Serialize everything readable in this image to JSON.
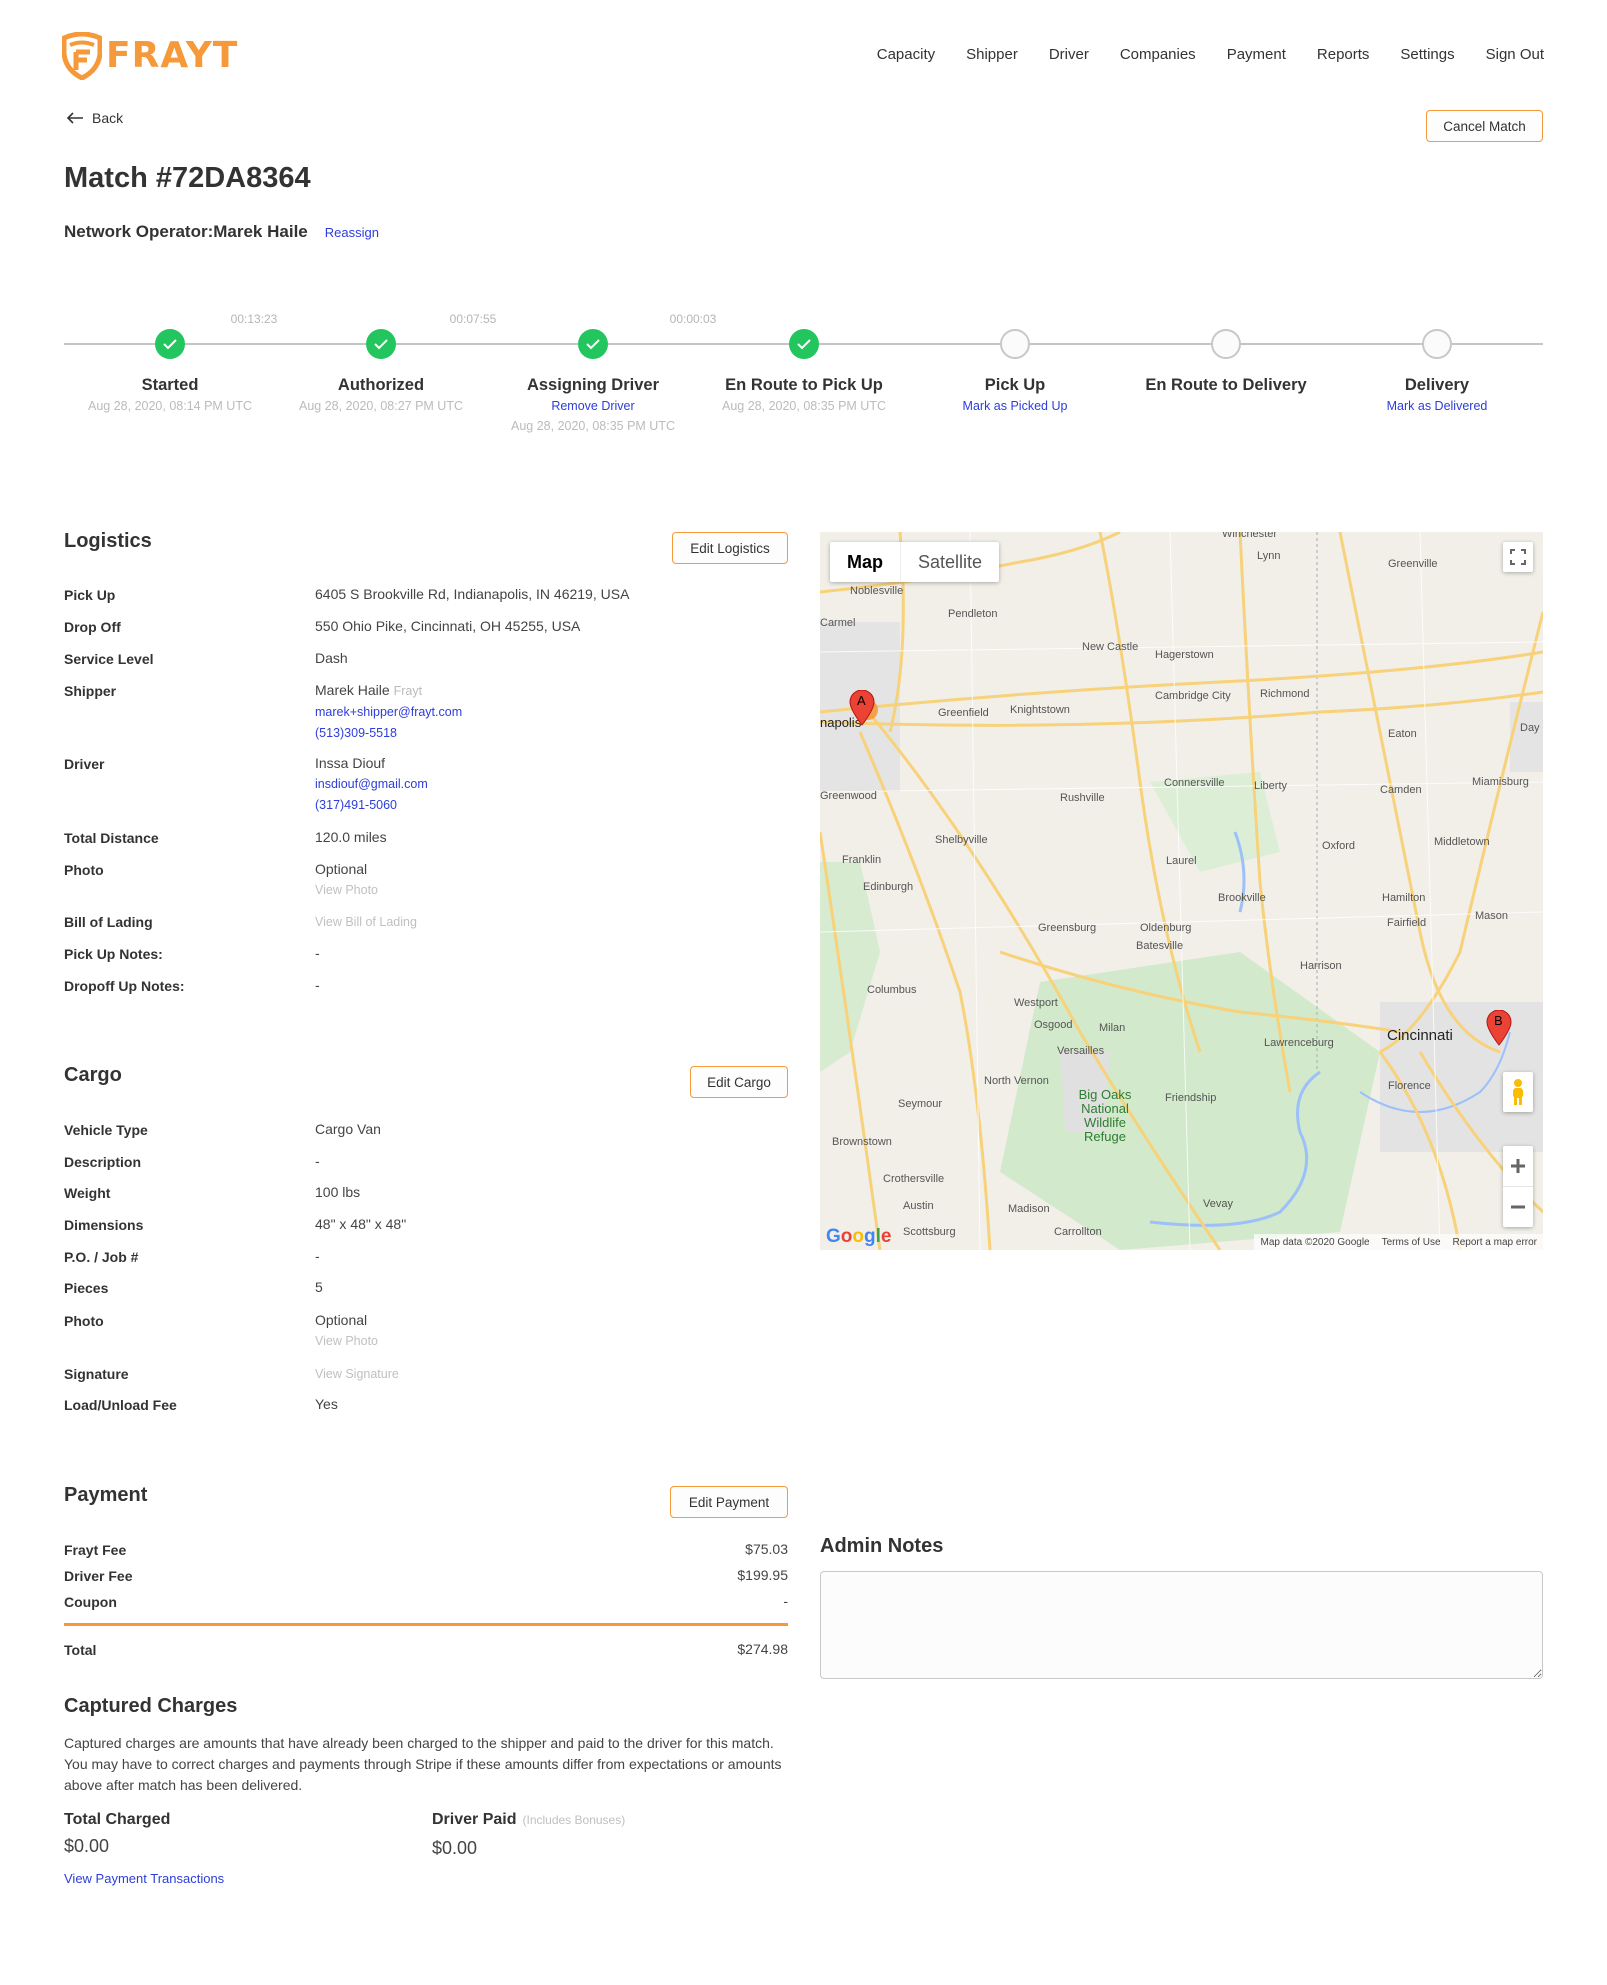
{
  "brand": {
    "name": "FRAYT",
    "color": "#f5993a"
  },
  "nav": {
    "items": [
      "Capacity",
      "Shipper",
      "Driver",
      "Companies",
      "Payment",
      "Reports",
      "Settings",
      "Sign Out"
    ]
  },
  "back_label": "Back",
  "cancel_match_label": "Cancel Match",
  "match": {
    "title": "Match #72DA8364",
    "operator_label": "Network Operator:",
    "operator_name": "Marek Haile",
    "reassign_label": "Reassign"
  },
  "timeline": {
    "timers": [
      "00:13:23",
      "00:07:55",
      "00:00:03"
    ],
    "steps": [
      {
        "label": "Started",
        "status": "done",
        "date": "Aug 28, 2020, 08:14 PM UTC"
      },
      {
        "label": "Authorized",
        "status": "done",
        "date": "Aug 28, 2020, 08:27 PM UTC"
      },
      {
        "label": "Assigning Driver",
        "status": "done",
        "action": "Remove Driver",
        "date": "Aug 28, 2020, 08:35 PM UTC"
      },
      {
        "label": "En Route to Pick Up",
        "status": "done",
        "date": "Aug 28, 2020, 08:35 PM UTC"
      },
      {
        "label": "Pick Up",
        "status": "pending",
        "action": "Mark as Picked Up"
      },
      {
        "label": "En Route to Delivery",
        "status": "pending"
      },
      {
        "label": "Delivery",
        "status": "pending",
        "action": "Mark as Delivered"
      }
    ],
    "done_color": "#22c55e"
  },
  "logistics": {
    "heading": "Logistics",
    "edit_label": "Edit Logistics",
    "pickup_label": "Pick Up",
    "pickup": "6405 S Brookville Rd, Indianapolis, IN 46219, USA",
    "dropoff_label": "Drop Off",
    "dropoff": "550 Ohio Pike, Cincinnati, OH 45255, USA",
    "service_label": "Service Level",
    "service": "Dash",
    "shipper_label": "Shipper",
    "shipper_name": "Marek Haile",
    "shipper_company": "Frayt",
    "shipper_email": "marek+shipper@frayt.com",
    "shipper_phone": "(513)309-5518",
    "driver_label": "Driver",
    "driver_name": "Inssa Diouf",
    "driver_email": "insdiouf@gmail.com",
    "driver_phone": "(317)491-5060",
    "distance_label": "Total Distance",
    "distance": "120.0 miles",
    "photo_label": "Photo",
    "photo": "Optional",
    "view_photo": "View Photo",
    "bol_label": "Bill of Lading",
    "view_bol": "View Bill of Lading",
    "pickup_notes_label": "Pick Up Notes:",
    "pickup_notes": "-",
    "dropoff_notes_label": "Dropoff Up Notes:",
    "dropoff_notes": "-"
  },
  "cargo": {
    "heading": "Cargo",
    "edit_label": "Edit Cargo",
    "rows": [
      {
        "label": "Vehicle Type",
        "value": "Cargo Van"
      },
      {
        "label": "Description",
        "value": "-"
      },
      {
        "label": "Weight",
        "value": "100 lbs"
      },
      {
        "label": "Dimensions",
        "value": "48\" x 48\" x 48\""
      },
      {
        "label": "P.O. / Job #",
        "value": "-"
      },
      {
        "label": "Pieces",
        "value": "5"
      }
    ],
    "photo_label": "Photo",
    "photo": "Optional",
    "view_photo": "View Photo",
    "signature_label": "Signature",
    "view_signature": "View Signature",
    "load_fee_label": "Load/Unload Fee",
    "load_fee": "Yes"
  },
  "map": {
    "type_map": "Map",
    "type_satellite": "Satellite",
    "marker_a": "A",
    "marker_b": "B",
    "google": "Google",
    "attribution": [
      "Map data ©2020 Google",
      "Terms of Use",
      "Report a map error"
    ],
    "labels": [
      "Noblesville",
      "Carmel",
      "Pendleton",
      "New Castle",
      "Hagerstown",
      "Cambridge City",
      "Richmond",
      "Greenville",
      "Lynn",
      "Eaton",
      "Greenfield",
      "Knightstown",
      "Greenwood",
      "Rushville",
      "Connersville",
      "Liberty",
      "Camden",
      "Miamisburg",
      "Shelbyville",
      "Franklin",
      "Laurel",
      "Brookville",
      "Oxford",
      "Middletown",
      "Edinburgh",
      "Greensburg",
      "Oldenburg",
      "Batesville",
      "Hamilton",
      "Fairfield",
      "Mason",
      "Columbus",
      "Westport",
      "Harrison",
      "Osgood",
      "Milan",
      "Lawrenceburg",
      "Versailles",
      "North Vernon",
      "Seymour",
      "Friendship",
      "Florence",
      "Brownstown",
      "Crothersville",
      "Austin",
      "Madison",
      "Vevay",
      "Scottsburg",
      "Carrollton",
      "Day",
      "Winchester"
    ],
    "city_cincinnati": "Cincinnati",
    "city_indianapolis": "napolis",
    "park": "Big Oaks National Wildlife Refuge"
  },
  "payment": {
    "heading": "Payment",
    "edit_label": "Edit Payment",
    "frayt_fee_label": "Frayt Fee",
    "frayt_fee": "$75.03",
    "driver_fee_label": "Driver Fee",
    "driver_fee": "$199.95",
    "coupon_label": "Coupon",
    "coupon": "-",
    "total_label": "Total",
    "total": "$274.98"
  },
  "captured": {
    "heading": "Captured Charges",
    "description": "Captured charges are amounts that have already been charged to the shipper and paid to the driver for this match. You may have to correct charges and payments through Stripe if these amounts differ from expectations or amounts above after match has been delivered.",
    "total_charged_label": "Total Charged",
    "total_charged": "$0.00",
    "driver_paid_label": "Driver Paid",
    "driver_paid_note": "(Includes Bonuses)",
    "driver_paid": "$0.00",
    "view_transactions": "View Payment Transactions"
  },
  "admin_notes": {
    "heading": "Admin Notes",
    "value": ""
  }
}
